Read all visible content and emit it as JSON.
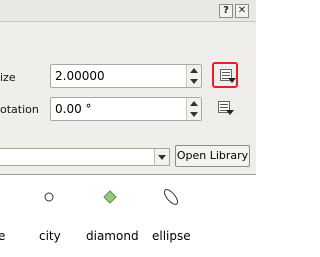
{
  "window": {
    "help_label": "?",
    "close_label": "✕"
  },
  "properties": {
    "size_label": "ize",
    "size_value": "2.00000",
    "rotation_label": "otation",
    "rotation_value": "0.00 °"
  },
  "library": {
    "combo_value": "",
    "open_library_label": "Open Library"
  },
  "symbols": [
    {
      "name": "e",
      "icon": "none"
    },
    {
      "name": "city",
      "icon": "circle-icon"
    },
    {
      "name": "diamond",
      "icon": "diamond-icon"
    },
    {
      "name": "ellipse",
      "icon": "ellipse-icon"
    }
  ],
  "colors": {
    "highlight": "#e3202a",
    "diamond_fill": "#9dc87f",
    "diamond_stroke": "#5f8f45"
  }
}
